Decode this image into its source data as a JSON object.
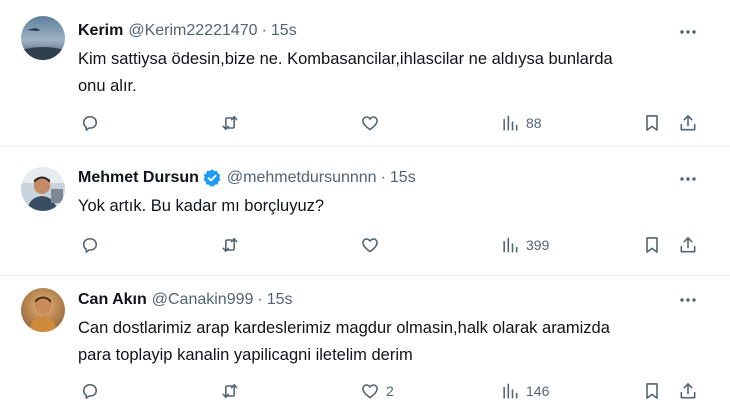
{
  "tweets": [
    {
      "name": "Kerim",
      "handle": "@Kerim22221470",
      "separator": "·",
      "time": "15s",
      "verified": false,
      "lines": [
        "Kim sattiysa ödesin,bize ne. Kombasancilar,ihlascilar ne aldıysa bunlarda",
        "onu alır."
      ],
      "replies": "",
      "retweets": "",
      "likes": "",
      "views": "88"
    },
    {
      "name": "Mehmet Dursun",
      "handle": "@mehmetdursunnnn",
      "separator": "·",
      "time": "15s",
      "verified": true,
      "lines": [
        "Yok artık. Bu kadar mı borçluyuz?"
      ],
      "replies": "",
      "retweets": "",
      "likes": "",
      "views": "399"
    },
    {
      "name": "Can Akın",
      "handle": "@Canakin999",
      "separator": "·",
      "time": "15s",
      "verified": false,
      "lines": [
        "Can dostlarimiz arap kardeslerimiz magdur olmasin,halk olarak aramizda",
        "para toplayip kanalin yapilicagni iletelim derim"
      ],
      "replies": "",
      "retweets": "",
      "likes": "2",
      "views": "146"
    }
  ],
  "colors": {
    "text": "#0f1419",
    "secondary": "#536471",
    "divider": "#eff3f4",
    "verified": "#1d9bf0"
  },
  "icons": [
    "reply-icon",
    "retweet-icon",
    "like-icon",
    "views-icon",
    "bookmark-icon",
    "share-icon",
    "more-icon",
    "verified-badge-icon"
  ]
}
